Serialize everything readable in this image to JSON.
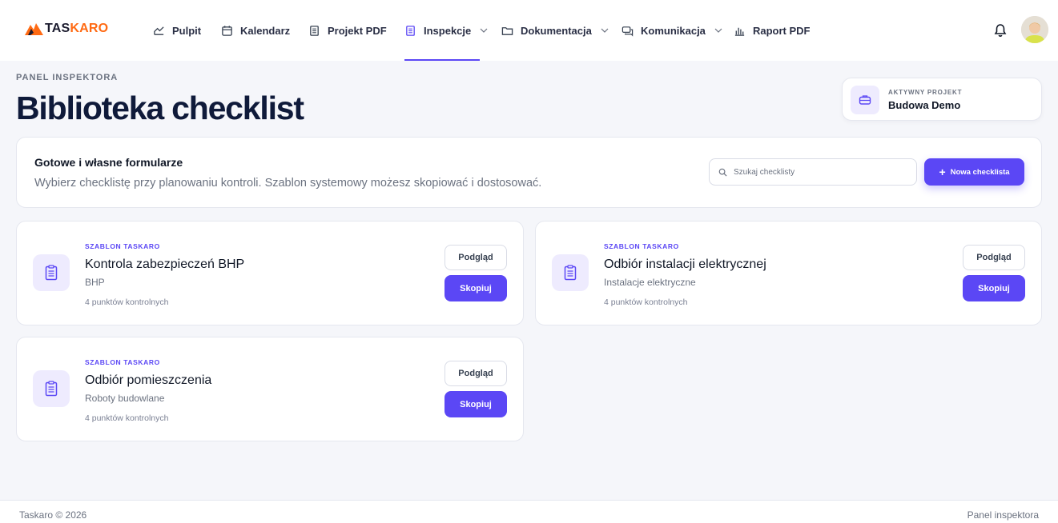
{
  "brand": {
    "name_a": "TAS",
    "name_b": "KARO",
    "accent": "#5b47f5",
    "logo_color": "#ff6a13"
  },
  "nav": {
    "items": [
      {
        "label": "Pulpit",
        "icon": "chart-line-icon"
      },
      {
        "label": "Kalendarz",
        "icon": "calendar-icon"
      },
      {
        "label": "Projekt PDF",
        "icon": "document-icon"
      },
      {
        "label": "Inspekcje",
        "icon": "list-document-icon",
        "active": true,
        "dropdown": true
      },
      {
        "label": "Dokumentacja",
        "icon": "folder-icon",
        "dropdown": true
      },
      {
        "label": "Komunikacja",
        "icon": "chat-icon",
        "dropdown": true
      },
      {
        "label": "Raport PDF",
        "icon": "bar-chart-icon"
      }
    ]
  },
  "header": {
    "eyebrow": "PANEL INSPEKTORA",
    "title": "Biblioteka checklist"
  },
  "project": {
    "label": "AKTYWNY PROJEKT",
    "name": "Budowa Demo"
  },
  "intro": {
    "title": "Gotowe i własne formularze",
    "description": "Wybierz checklistę przy planowaniu kontroli. Szablon systemowy możesz skopiować i dostosować.",
    "search_placeholder": "Szukaj checklisty",
    "new_button": "Nowa checklista"
  },
  "templates": [
    {
      "eyebrow": "SZABLON TASKARO",
      "title": "Kontrola zabezpieczeń BHP",
      "category": "BHP",
      "count": "4 punktów kontrolnych",
      "preview": "Podgląd",
      "copy": "Skopiuj"
    },
    {
      "eyebrow": "SZABLON TASKARO",
      "title": "Odbiór instalacji elektrycznej",
      "category": "Instalacje elektryczne",
      "count": "4 punktów kontrolnych",
      "preview": "Podgląd",
      "copy": "Skopiuj"
    },
    {
      "eyebrow": "SZABLON TASKARO",
      "title": "Odbiór pomieszczenia",
      "category": "Roboty budowlane",
      "count": "4 punktów kontrolnych",
      "preview": "Podgląd",
      "copy": "Skopiuj"
    }
  ],
  "footer": {
    "left": "Taskaro © 2026",
    "right": "Panel inspektora"
  }
}
